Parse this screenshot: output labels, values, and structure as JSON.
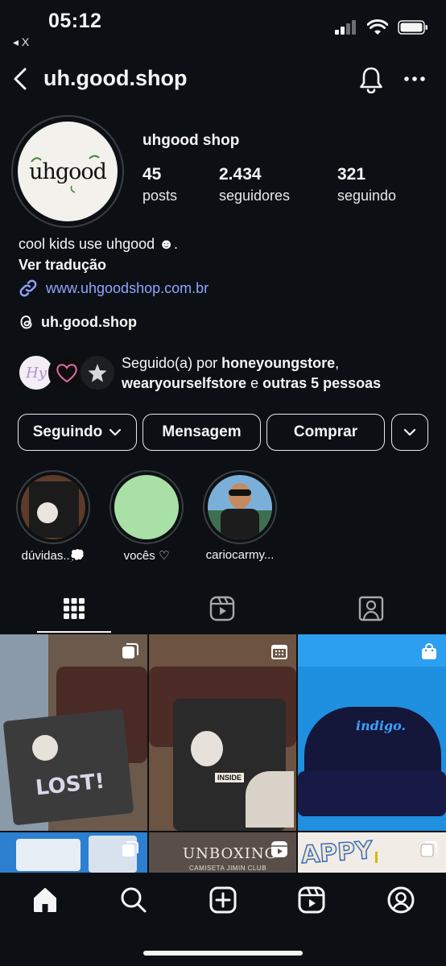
{
  "status_bar": {
    "time": "05:12",
    "back_app": "◂ X"
  },
  "nav": {
    "username": "uh.good.shop"
  },
  "profile": {
    "avatar_text": "uhgood",
    "display_name": "uhgood shop",
    "stats": [
      {
        "value": "45",
        "label": "posts"
      },
      {
        "value": "2.434",
        "label": "seguidores"
      },
      {
        "value": "321",
        "label": "seguindo"
      }
    ],
    "bio": "cool kids use uhgood ☻.",
    "translate": "Ver tradução",
    "link": "www.uhgoodshop.com.br",
    "threads": "uh.good.shop",
    "followed_by": {
      "prefix": "Seguido(a) por ",
      "user1": "honeyoungstore",
      "sep": ",",
      "user2": "wearyourselfstore",
      "conj": " e ",
      "others": "outras 5 pessoas"
    }
  },
  "buttons": {
    "following": "Seguindo",
    "message": "Mensagem",
    "shop": "Comprar"
  },
  "highlights": [
    {
      "label": "dúvidas..💭"
    },
    {
      "label": "vocês ♡"
    },
    {
      "label": "cariocarmy..."
    }
  ],
  "grid": [
    {
      "caption": "LOST!"
    },
    {
      "caption": "INSIDE"
    },
    {
      "caption": "indigo."
    },
    {
      "caption": ""
    },
    {
      "caption": "UNBOXING",
      "sub": "CAMISETA JIMIN CLUB"
    },
    {
      "caption": "APPY"
    }
  ],
  "colors": {
    "background": "#0c1014",
    "link": "#8fa3ff",
    "highlight_green": "#a8e0a5"
  }
}
